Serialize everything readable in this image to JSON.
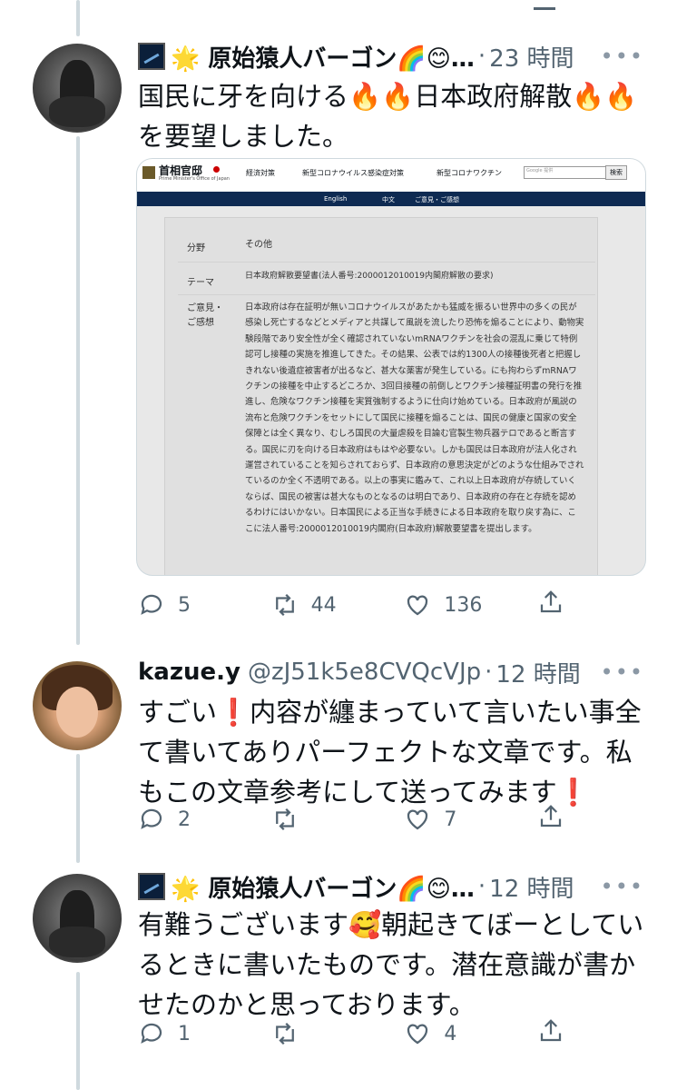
{
  "tweets": [
    {
      "name": "🌟 原始猿人バーゴン🌈😊…",
      "handle": "",
      "sep": "·",
      "time": "23 時間",
      "text": "国民に牙を向ける🔥🔥日本政府解散🔥🔥を要望しました。",
      "reply_count": "5",
      "retweet_count": "44",
      "like_count": "136"
    },
    {
      "name": "kazue.y",
      "handle": "@zJ51k5e8CVQcVJp",
      "sep": "·",
      "time": "12 時間",
      "text": "すごい❗️内容が纏まっていて言いたい事全て書いてありパーフェクトな文章です。私もこの文章参考にして送ってみます❗️",
      "reply_count": "2",
      "retweet_count": "",
      "like_count": "7"
    },
    {
      "name": "🌟 原始猿人バーゴン🌈😊…",
      "handle": "",
      "sep": "·",
      "time": "12 時間",
      "text": "有難うございます🥰朝起きてぼーとしているときに書いたものです。潜在意識が書かせたのかと思っております。",
      "reply_count": "1",
      "retweet_count": "",
      "like_count": "4"
    }
  ],
  "embed": {
    "site_name": "首相官邸",
    "site_sub": "Prime Minister's Office of Japan",
    "nav": [
      "経済対策",
      "新型コロナウイルス感染症対策",
      "新型コロナワクチン"
    ],
    "search_placeholder": "Google 提供",
    "search_button": "検索",
    "subnav": [
      "English",
      "中文",
      "ご意見・ご感想"
    ],
    "rows": [
      {
        "label": "分野",
        "value": "その他"
      },
      {
        "label": "テーマ",
        "value": "日本政府解散要望書(法人番号:2000012010019内閣府解散の要求)"
      },
      {
        "label": "ご意見・ご感想",
        "value": "日本政府は存在証明が無いコロナウイルスがあたかも猛威を振るい世界中の多くの民が感染し死亡するなどとメディアと共謀して風説を流したり恐怖を煽ることにより、動物実験段階であり安全性が全く確認されていないmRNAワクチンを社会の混乱に乗じて特例認可し接種の実施を推進してきた。その結果、公表では約1300人の接種後死者と把握しきれない後遺症被害者が出るなど、甚大な薬害が発生している。にも拘わらずmRNAワクチンの接種を中止するどころか、3回目接種の前倒しとワクチン接種証明書の発行を推進し、危険なワクチン接種を実質強制するように仕向け始めている。日本政府が風説の流布と危険ワクチンをセットにして国民に接種を煽ることは、国民の健康と国家の安全保障とは全く異なり、むしろ国民の大量虐殺を目論む官製生物兵器テロであると断言する。国民に刃を向ける日本政府はもはや必要ない。しかも国民は日本政府が法人化され運営されていることを知らされておらず、日本政府の意思決定がどのような仕組みでされているのか全く不透明である。以上の事実に鑑みて、これ以上日本政府が存続していくならば、国民の被害は甚大なものとなるのは明白であり、日本政府の存在と存続を認めるわけにはいかない。日本国民による正当な手続きによる日本政府を取り戻す為に、ここに法人番号:2000012010019内閣府(日本政府)解散要望書を提出します。"
      }
    ]
  }
}
